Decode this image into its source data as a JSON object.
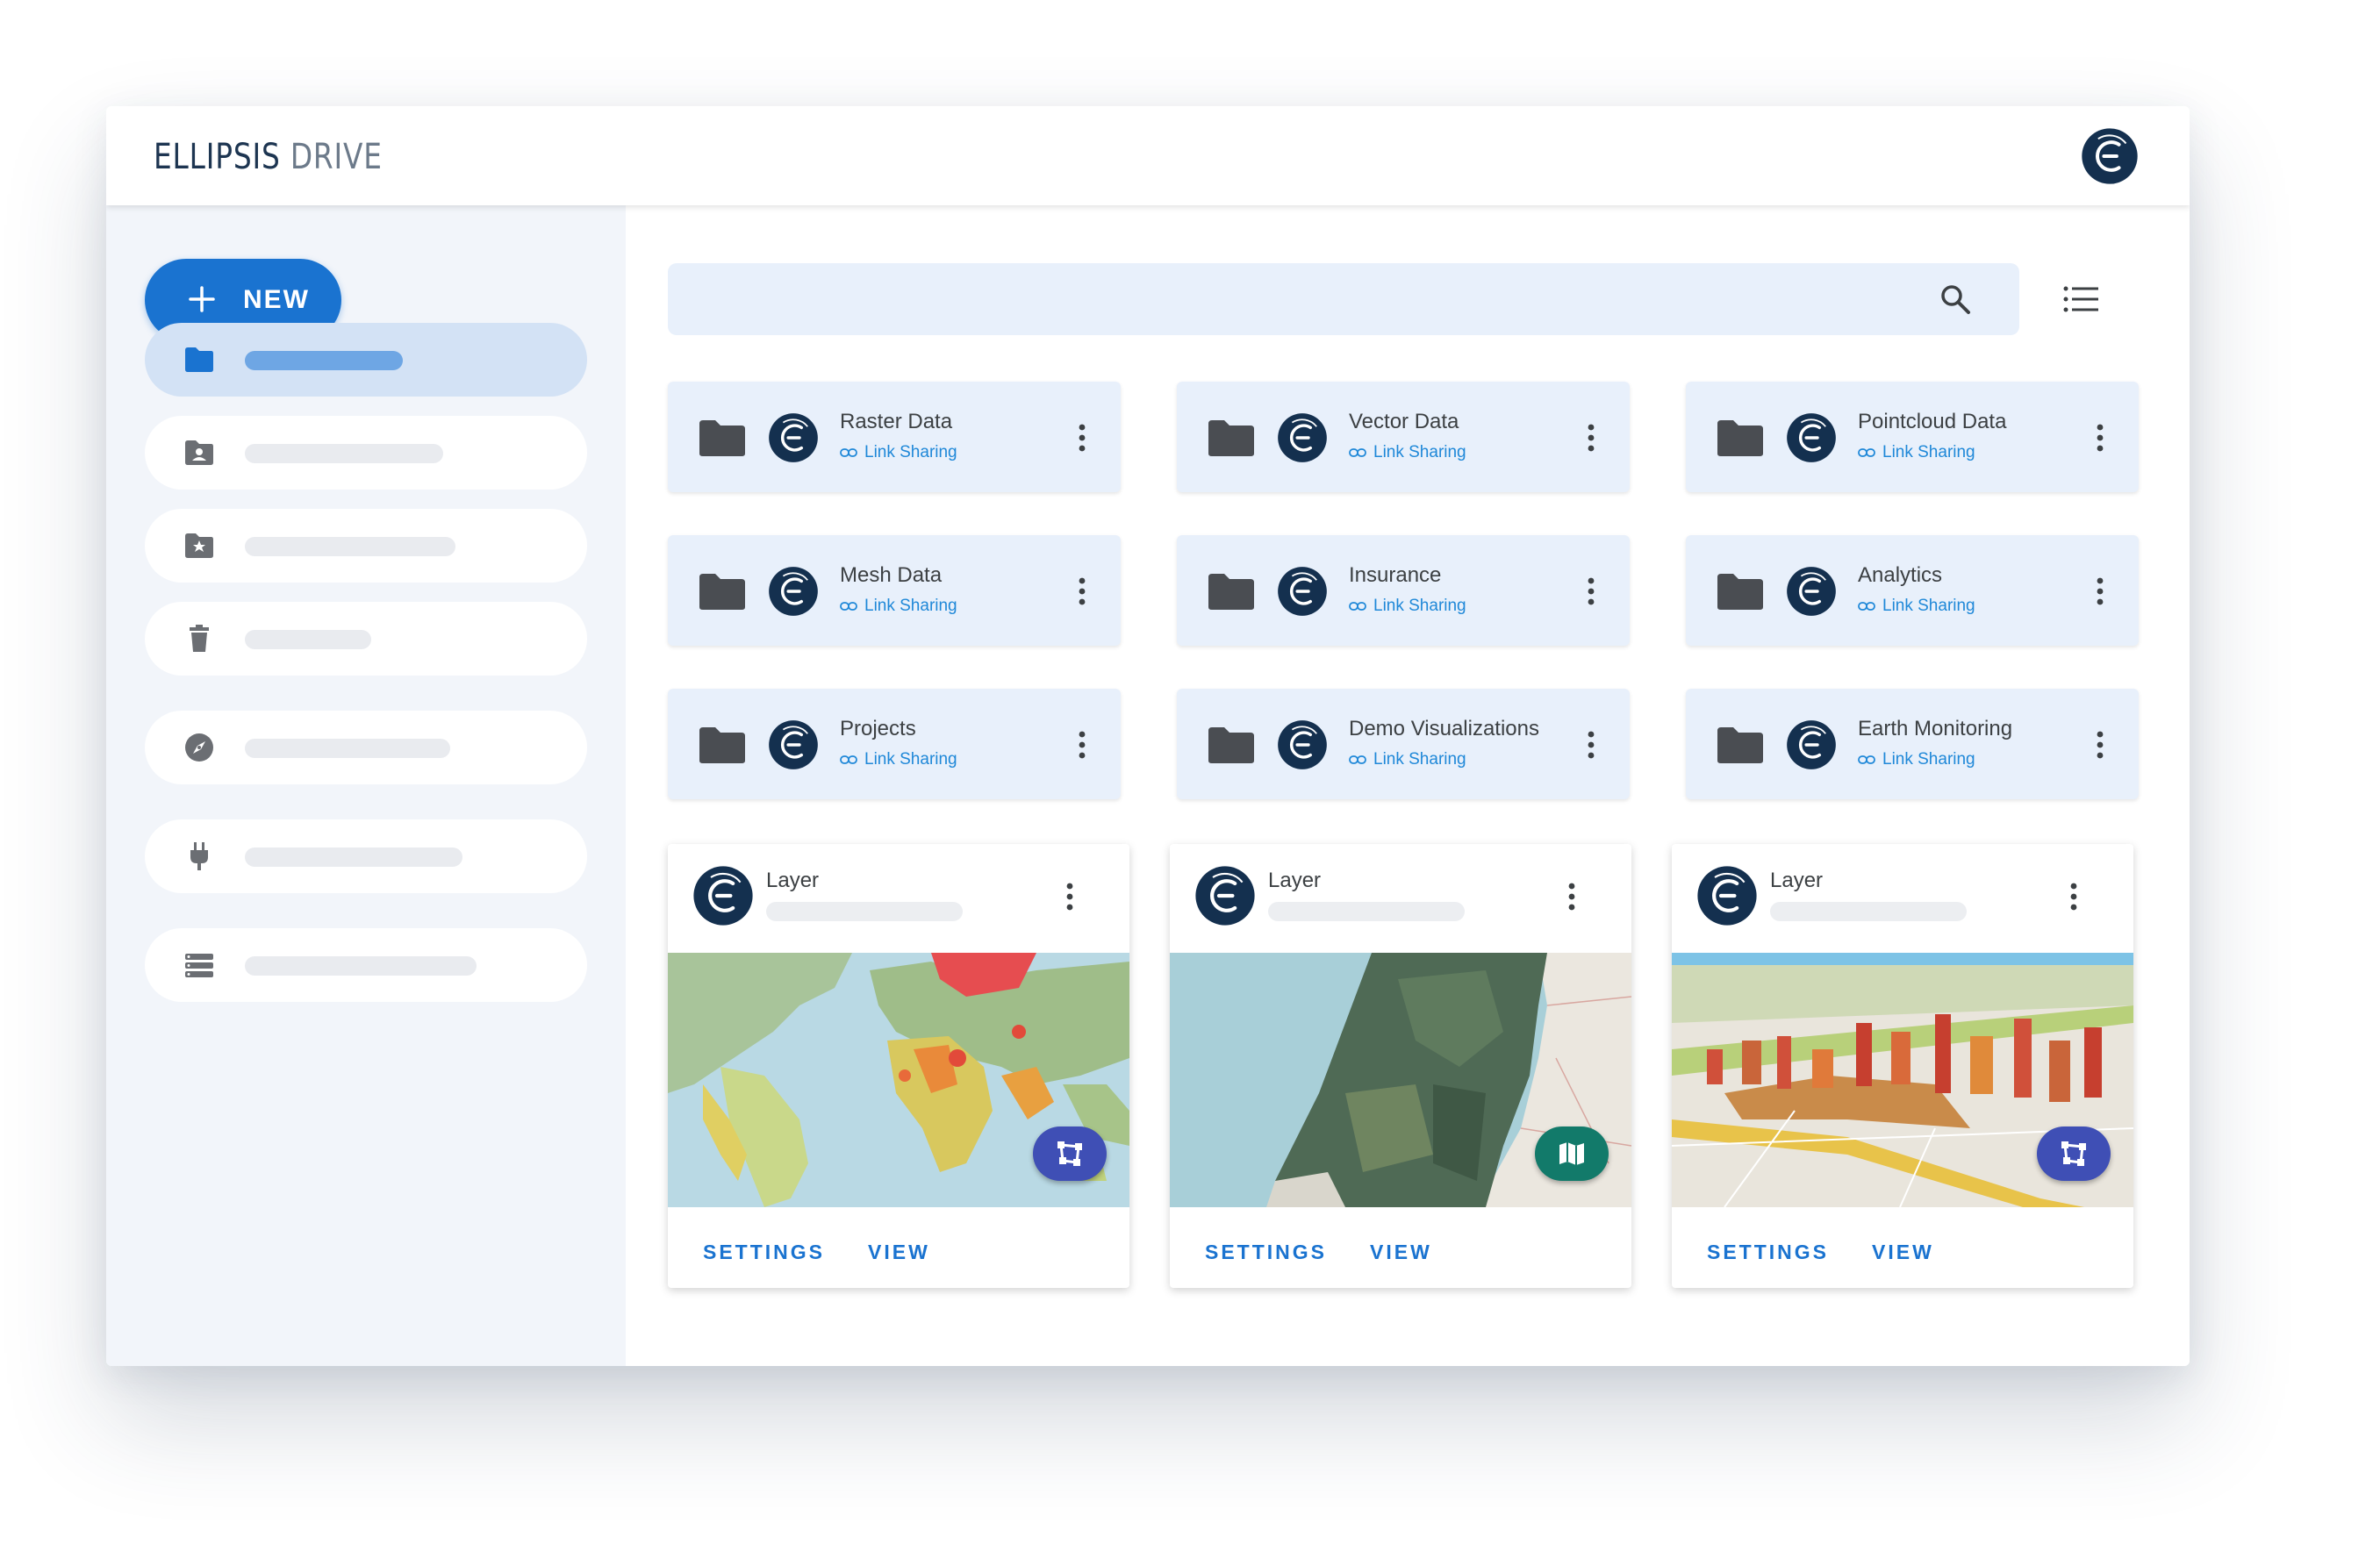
{
  "app": {
    "logo_primary": "ELLIPSIS",
    "logo_secondary": "DRIVE",
    "brand_color": "#1d3551",
    "accent_color": "#1a73d0"
  },
  "header": {
    "avatar_icon": "ellipsis-logo-icon"
  },
  "sidebar": {
    "new_button": {
      "label": "NEW",
      "icon": "plus-icon"
    },
    "items": [
      {
        "icon": "folder-icon",
        "active": true
      },
      {
        "icon": "shared-folder-icon",
        "active": false
      },
      {
        "icon": "starred-folder-icon",
        "active": false
      },
      {
        "icon": "trash-icon",
        "active": false
      },
      {
        "icon": "compass-icon",
        "active": false
      },
      {
        "icon": "plug-icon",
        "active": false
      },
      {
        "icon": "storage-icon",
        "active": false
      }
    ]
  },
  "search": {
    "placeholder": "",
    "value": "",
    "icon": "search-icon",
    "view_toggle_icon": "list-view-icon"
  },
  "folders": [
    {
      "name": "Raster Data",
      "sharing": "Link Sharing"
    },
    {
      "name": "Vector Data",
      "sharing": "Link Sharing"
    },
    {
      "name": "Pointcloud Data",
      "sharing": "Link Sharing"
    },
    {
      "name": "Mesh Data",
      "sharing": "Link Sharing"
    },
    {
      "name": "Insurance",
      "sharing": "Link Sharing"
    },
    {
      "name": "Analytics",
      "sharing": "Link Sharing"
    },
    {
      "name": "Projects",
      "sharing": "Link Sharing"
    },
    {
      "name": "Demo Visualizations",
      "sharing": "Link Sharing"
    },
    {
      "name": "Earth Monitoring",
      "sharing": "Link Sharing"
    }
  ],
  "cards": [
    {
      "title": "Layer",
      "settings_label": "SETTINGS",
      "view_label": "VIEW",
      "fab_icon": "polygon-edit-icon",
      "fab_color": "#3f4fb5"
    },
    {
      "title": "Layer",
      "settings_label": "SETTINGS",
      "view_label": "VIEW",
      "fab_icon": "map-icon",
      "fab_color": "#127a6a"
    },
    {
      "title": "Layer",
      "settings_label": "SETTINGS",
      "view_label": "VIEW",
      "fab_icon": "polygon-edit-icon",
      "fab_color": "#3f4fb5"
    }
  ]
}
